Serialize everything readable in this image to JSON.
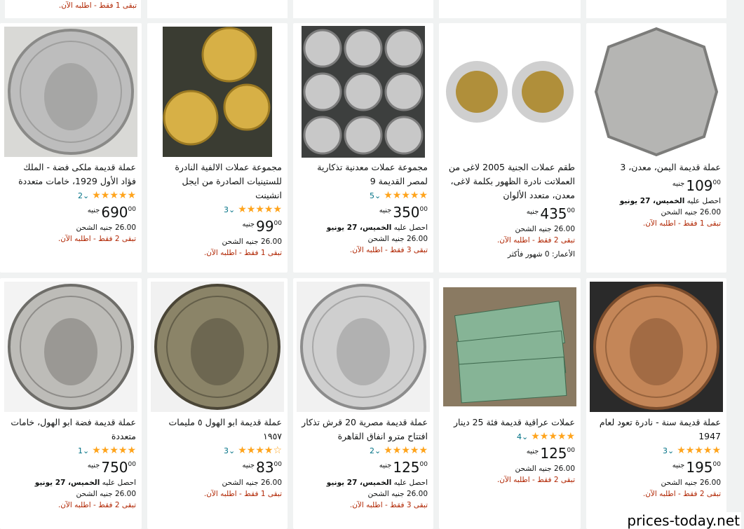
{
  "top_strip": {
    "stock_text": "تبقى 1 فقط - اطلبه الآن."
  },
  "rows": [
    [
      {
        "title": "عملة قديمة ملكى فضة - الملك فؤاد الأول 1929، خامات متعددة",
        "stars": "★★★★★",
        "rating_count": "2",
        "currency": "جنيه",
        "price_whole": "690",
        "price_frac": "00",
        "lines": [
          "26.00 جنيه الشحن"
        ],
        "stock": "تبقى 2 فقط - اطلبه الآن.",
        "image_icon": "king-fuad-silver-coin"
      },
      {
        "title": "مجموعة عملات الالفية النادرة للستينيات الصادرة من ايجل انشينت",
        "stars": "★★★★★",
        "rating_count": "3",
        "currency": "جنيه",
        "price_whole": "99",
        "price_frac": "00",
        "lines": [
          "26.00 جنيه الشحن"
        ],
        "stock": "تبقى 1 فقط - اطلبه الآن.",
        "image_icon": "eagle-brass-coins"
      },
      {
        "title": "مجموعة عملات معدنية تذكارية لمصر القديمة 9",
        "stars": "★★★★★",
        "rating_count": "5",
        "currency": "جنيه",
        "price_whole": "350",
        "price_frac": "00",
        "delivery_prefix": "احصل عليه",
        "delivery_day": "الخميس، 27 يونيو",
        "lines": [
          "26.00 جنيه الشحن"
        ],
        "stock": "تبقى 3 فقط - اطلبه الآن.",
        "image_icon": "nine-coins-grid"
      },
      {
        "title": "طقم عملات الجنية 2005 لاغى من العملاتت نادرة الظهور بكلمة لاغى، معدن، متعدد الألوان",
        "stars": "",
        "rating_count": "",
        "currency": "جنيه",
        "price_whole": "435",
        "price_frac": "00",
        "lines": [
          "26.00 جنيه الشحن"
        ],
        "stock": "تبقى 2 فقط - اطلبه الآن.",
        "extra": "الأعمار: 0 شهور فأكثر",
        "image_icon": "bimetal-pound-coins"
      },
      {
        "title": "عملة قديمة اليمن، معدن، 3",
        "stars": "",
        "rating_count": "",
        "currency": "جنيه",
        "price_whole": "109",
        "price_frac": "00",
        "delivery_prefix": "احصل عليه",
        "delivery_day": "الخميس، 27 يونيو",
        "lines": [
          "26.00 جنيه الشحن"
        ],
        "stock": "تبقى 1 فقط - اطلبه الآن.",
        "image_icon": "yemen-coin"
      }
    ],
    [
      {
        "title": "عملة قديمة فضة ابو الهول، خامات متعددة",
        "stars": "★★★★★",
        "rating_count": "1",
        "currency": "جنيه",
        "price_whole": "750",
        "price_frac": "00",
        "delivery_prefix": "احصل عليه",
        "delivery_day": "الخميس، 27 يونيو",
        "lines": [
          "26.00 جنيه الشحن"
        ],
        "stock": "تبقى 2 فقط - اطلبه الآن.",
        "image_icon": "sphinx-silver-coin"
      },
      {
        "title": "عملة قديمة ابو الهول ٥ مليمات ١٩٥٧",
        "stars": "★★★★☆",
        "rating_count": "3",
        "currency": "جنيه",
        "price_whole": "83",
        "price_frac": "00",
        "lines": [
          "26.00 جنيه الشحن"
        ],
        "stock": "تبقى 1 فقط - اطلبه الآن.",
        "image_icon": "sphinx-bronze-coin"
      },
      {
        "title": "عملة قديمة مصرية 20 قرش تذكار افتتاح مترو انفاق القاهرة",
        "stars": "★★★★★",
        "rating_count": "2",
        "currency": "جنيه",
        "price_whole": "125",
        "price_frac": "00",
        "delivery_prefix": "احصل عليه",
        "delivery_day": "الخميس، 27 يونيو",
        "lines": [
          "26.00 جنيه الشحن"
        ],
        "stock": "تبقى 3 فقط - اطلبه الآن.",
        "image_icon": "metro-silver-coin"
      },
      {
        "title": "عملات عراقية قديمة فئة 25 دينار",
        "stars": "★★★★★",
        "rating_count": "4",
        "currency": "جنيه",
        "price_whole": "125",
        "price_frac": "00",
        "lines": [
          "26.00 جنيه الشحن"
        ],
        "stock": "تبقى 2 فقط - اطلبه الآن.",
        "image_icon": "iraqi-banknotes"
      },
      {
        "title": "عملة قديمة سنة - نادرة تعود لعام 1947",
        "stars": "★★★★★",
        "rating_count": "3",
        "currency": "جنيه",
        "price_whole": "195",
        "price_frac": "00",
        "lines": [
          "26.00 جنيه الشحن"
        ],
        "stock": "تبقى 2 فقط - اطلبه الآن.",
        "image_icon": "king-farouk-coin"
      }
    ]
  ],
  "watermark": "prices-today.net"
}
